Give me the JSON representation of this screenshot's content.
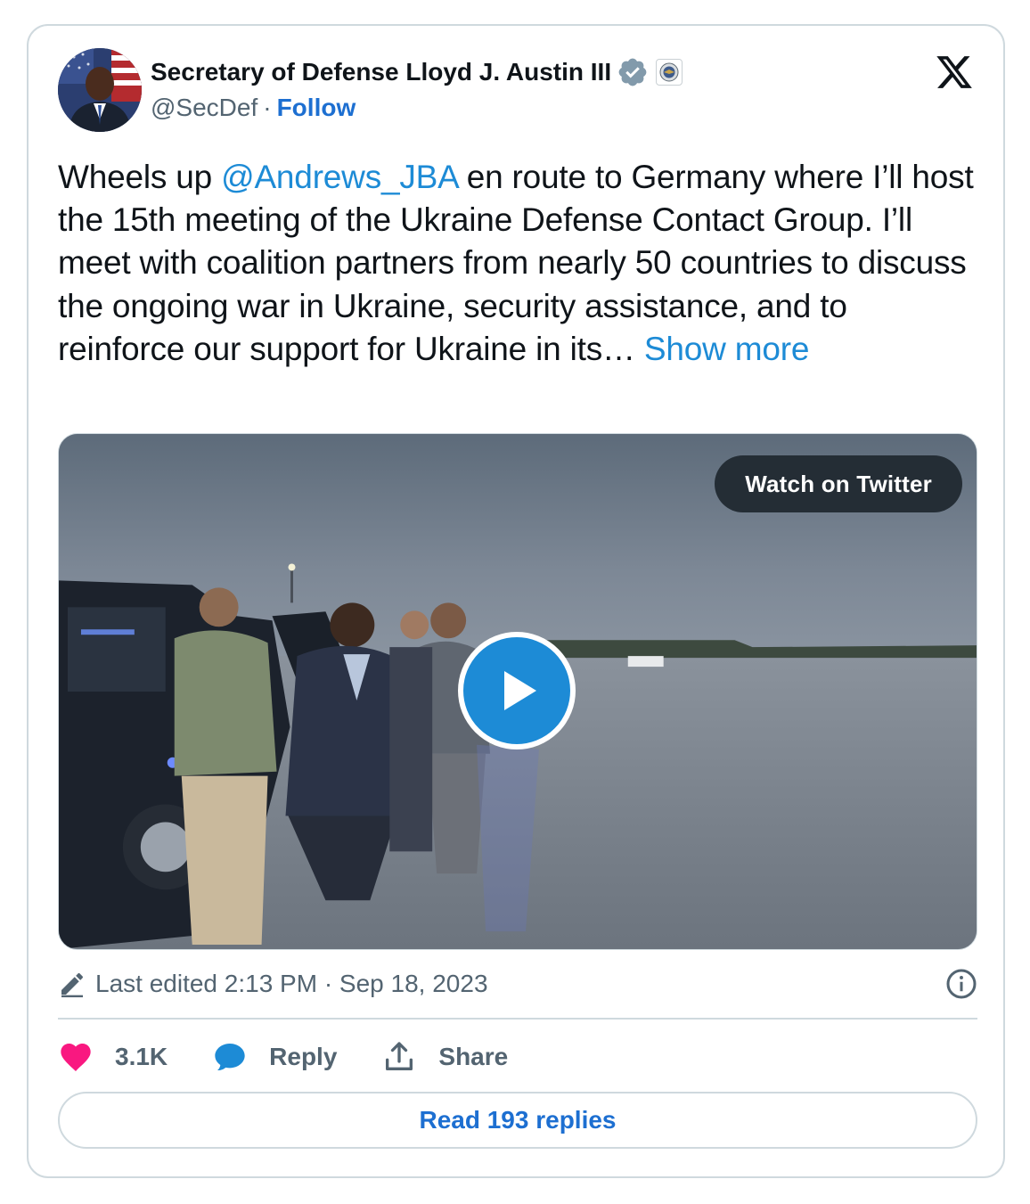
{
  "author": {
    "name": "Secretary of Defense Lloyd J. Austin III",
    "handle": "@SecDef",
    "separator": "·",
    "follow_label": "Follow",
    "verified_icon": "verified-badge-icon",
    "affiliation_icon": "dod-seal-icon"
  },
  "tweet": {
    "text_before_mention": "Wheels up ",
    "mention": "@Andrews_JBA",
    "text_after_mention": " en route to Germany where I’ll host the 15th meeting of the Ukraine Defense Contact Group. I’ll meet with coalition partners from nearly 50 countries to discuss the ongoing war in Ukraine, security assistance, and to reinforce our support for Ukraine in its…",
    "show_more_label": "Show more"
  },
  "media": {
    "watch_label": "Watch on Twitter",
    "play_icon": "play-icon"
  },
  "meta": {
    "edited_text": "Last edited 2:13 PM · Sep 18, 2023"
  },
  "actions": {
    "likes": "3.1K",
    "reply_label": "Reply",
    "share_label": "Share"
  },
  "read_replies_label": "Read 193 replies",
  "colors": {
    "link": "#1d8bd6",
    "follow": "#1d6fd1",
    "like": "#f91880",
    "border": "#cfd9de",
    "muted": "#536471"
  }
}
